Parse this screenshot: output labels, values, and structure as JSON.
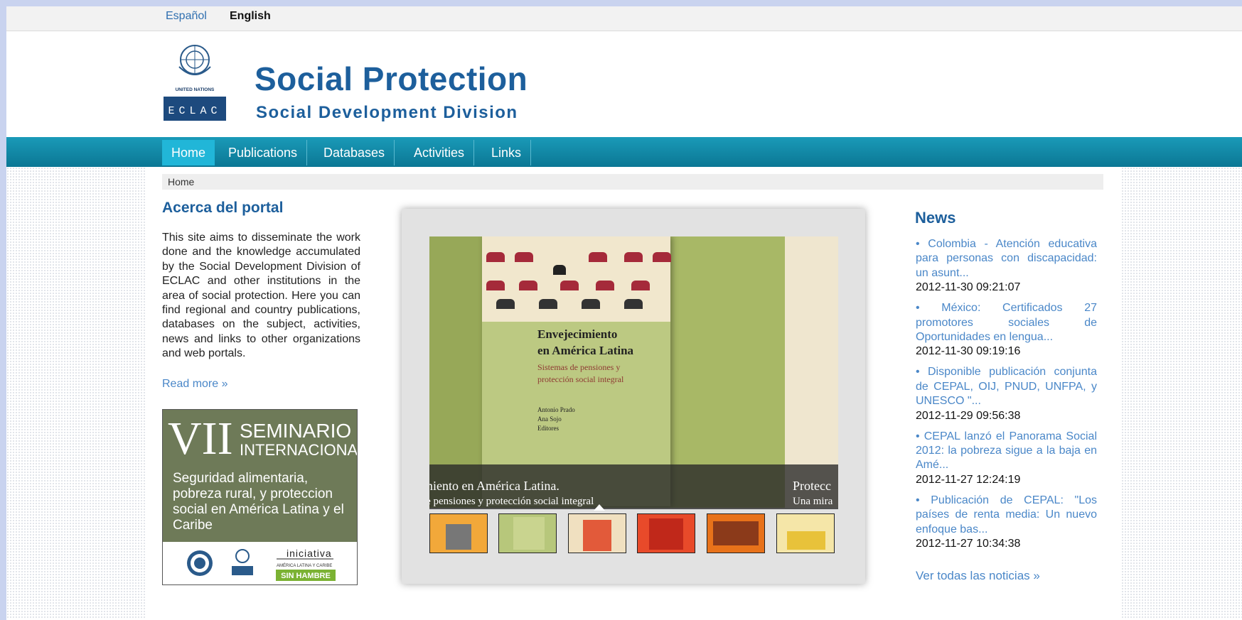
{
  "lang": {
    "es": "Español",
    "en": "English"
  },
  "header": {
    "title": "Social Protection",
    "subtitle": "Social Development Division",
    "logo_text_un": "UNITED NATIONS",
    "logo_text_eclac": "ECLAC"
  },
  "nav": {
    "items": [
      "Home",
      "Publications",
      "Databases",
      "Activities",
      "Links"
    ]
  },
  "breadcrumb": "Home",
  "about": {
    "title": "Acerca del portal",
    "text": "This site aims to disseminate the work done and the knowledge accumulated by the Social Development Division of ECLAC and other institutions in the area of social protection. Here you can find regional and country publications, databases on the subject, activities, news and links to other organizations and web portals.",
    "read_more": "Read more »"
  },
  "banner": {
    "roman": "VII",
    "line1": "SEMINARIO",
    "line2": "INTERNACIONAL",
    "topic": "Seguridad alimentaria, pobreza rural, y proteccion social en América Latina y el Caribe",
    "iniciativa": "iniciativa",
    "sub": "AMÉRICA LATINA Y CARIBE",
    "sin_hambre": "SIN HAMBRE"
  },
  "carousel": {
    "book_title1": "Envejecimiento",
    "book_title2": "en América Latina",
    "book_sub1": "Sistemas de pensiones y",
    "book_sub2": "protección social integral",
    "book_author1": "Antonio Prado",
    "book_author2": "Ana Sojo",
    "book_author3": "Editores",
    "caption_title": "cimiento en América Latina.",
    "caption_sub": "s de pensiones y protección social integral",
    "caption_next_title": "Protecc",
    "caption_next_sub": "Una mira"
  },
  "news": {
    "title": "News",
    "items": [
      {
        "text": "Colombia - Atención educativa para personas con discapacidad: un asunt...",
        "date": "2012-11-30 09:21:07"
      },
      {
        "text": "México: Certificados 27 promotores sociales de Oportunidades en lengua...",
        "date": "2012-11-30 09:19:16"
      },
      {
        "text": "Disponible publicación conjunta de CEPAL, OIJ, PNUD, UNFPA, y UNESCO \"...",
        "date": "2012-11-29 09:56:38"
      },
      {
        "text": "CEPAL lanzó el Panorama Social 2012: la pobreza sigue a la baja en Amé...",
        "date": "2012-11-27 12:24:19"
      },
      {
        "text": "Publicación de CEPAL: \"Los países de renta media: Un nuevo enfoque bas...",
        "date": "2012-11-27 10:34:38"
      }
    ],
    "all_link": "Ver todas las noticias »"
  }
}
